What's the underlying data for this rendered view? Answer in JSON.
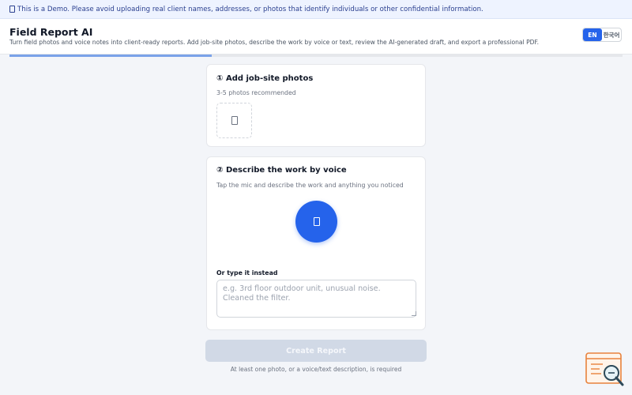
{
  "banner": {
    "icon": "info-icon",
    "text": "This is a Demo. Please avoid uploading real client names, addresses, or photos that identify individuals or other confidential information."
  },
  "header": {
    "title": "Field Report AI",
    "subtitle": "Turn field photos and voice notes into client-ready reports. Add job-site photos, describe the work by voice or text, review the AI-generated draft, and export a professional PDF.",
    "languages": [
      {
        "label": "EN",
        "active": true
      },
      {
        "label": "한국어",
        "active": false
      }
    ]
  },
  "progress": {
    "fraction": 0.33
  },
  "photos": {
    "heading": "① Add job-site photos",
    "hint": "3-5 photos recommended",
    "add_icon": "add-photo-icon"
  },
  "voice": {
    "heading": "② Describe the work by voice",
    "hint": "Tap the mic and describe the work and anything you noticed",
    "mic_icon": "microphone-icon",
    "type_label": "Or type it instead",
    "input_value": "",
    "input_placeholder": "e.g. 3rd floor outdoor unit, unusual noise. Cleaned the filter."
  },
  "actions": {
    "create_label": "Create Report",
    "create_disabled": true,
    "requirement_note": "At least one photo, or a voice/text description, is required"
  },
  "colors": {
    "accent": "#2563eb",
    "progress": "#7aa2e8",
    "disabled_button": "#d1d9e6",
    "banner_bg": "#eef3ff",
    "page_bg": "#f3f5f9",
    "help_widget": "#e8823c"
  }
}
